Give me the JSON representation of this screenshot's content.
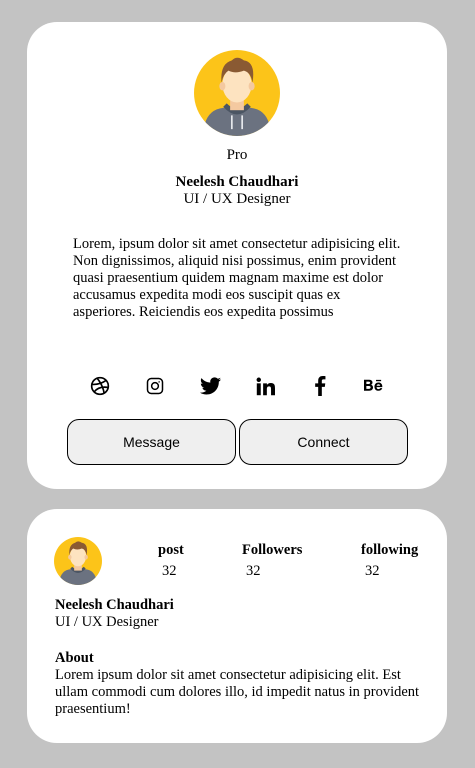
{
  "profile_card": {
    "badge": "Pro",
    "name": "Neelesh Chaudhari",
    "role": "UI / UX Designer",
    "bio": "Lorem, ipsum dolor sit amet consectetur adipisicing elit. Non dignissimos, aliquid nisi possimus, enim provident quasi praesentium quidem magnam maxime est dolor accusamus expedita modi eos suscipit quas ex asperiores. Reiciendis eos expedita possimus",
    "socials": [
      {
        "icon": "dribbble-icon"
      },
      {
        "icon": "instagram-icon"
      },
      {
        "icon": "twitter-icon"
      },
      {
        "icon": "linkedin-icon"
      },
      {
        "icon": "facebook-icon"
      },
      {
        "icon": "behance-icon"
      }
    ],
    "buttons": {
      "message": "Message",
      "connect": "Connect"
    }
  },
  "stats_card": {
    "stats": [
      {
        "label": "post",
        "value": "32"
      },
      {
        "label": "Followers",
        "value": "32"
      },
      {
        "label": "following",
        "value": "32"
      }
    ],
    "name": "Neelesh Chaudhari",
    "role": "UI / UX Designer",
    "about_title": "About",
    "about_text": "Lorem ipsum dolor sit amet consectetur adipisicing elit. Est ullam commodi cum dolores illo, id impedit natus in provident praesentium!"
  },
  "colors": {
    "page_background": "#c3c3c3",
    "card_background": "#ffffff",
    "avatar_circle": "#fcc419",
    "hair": "#8a5a33",
    "skin": "#fde3c0",
    "hoodie": "#6b7280",
    "button_background": "#efefef"
  }
}
